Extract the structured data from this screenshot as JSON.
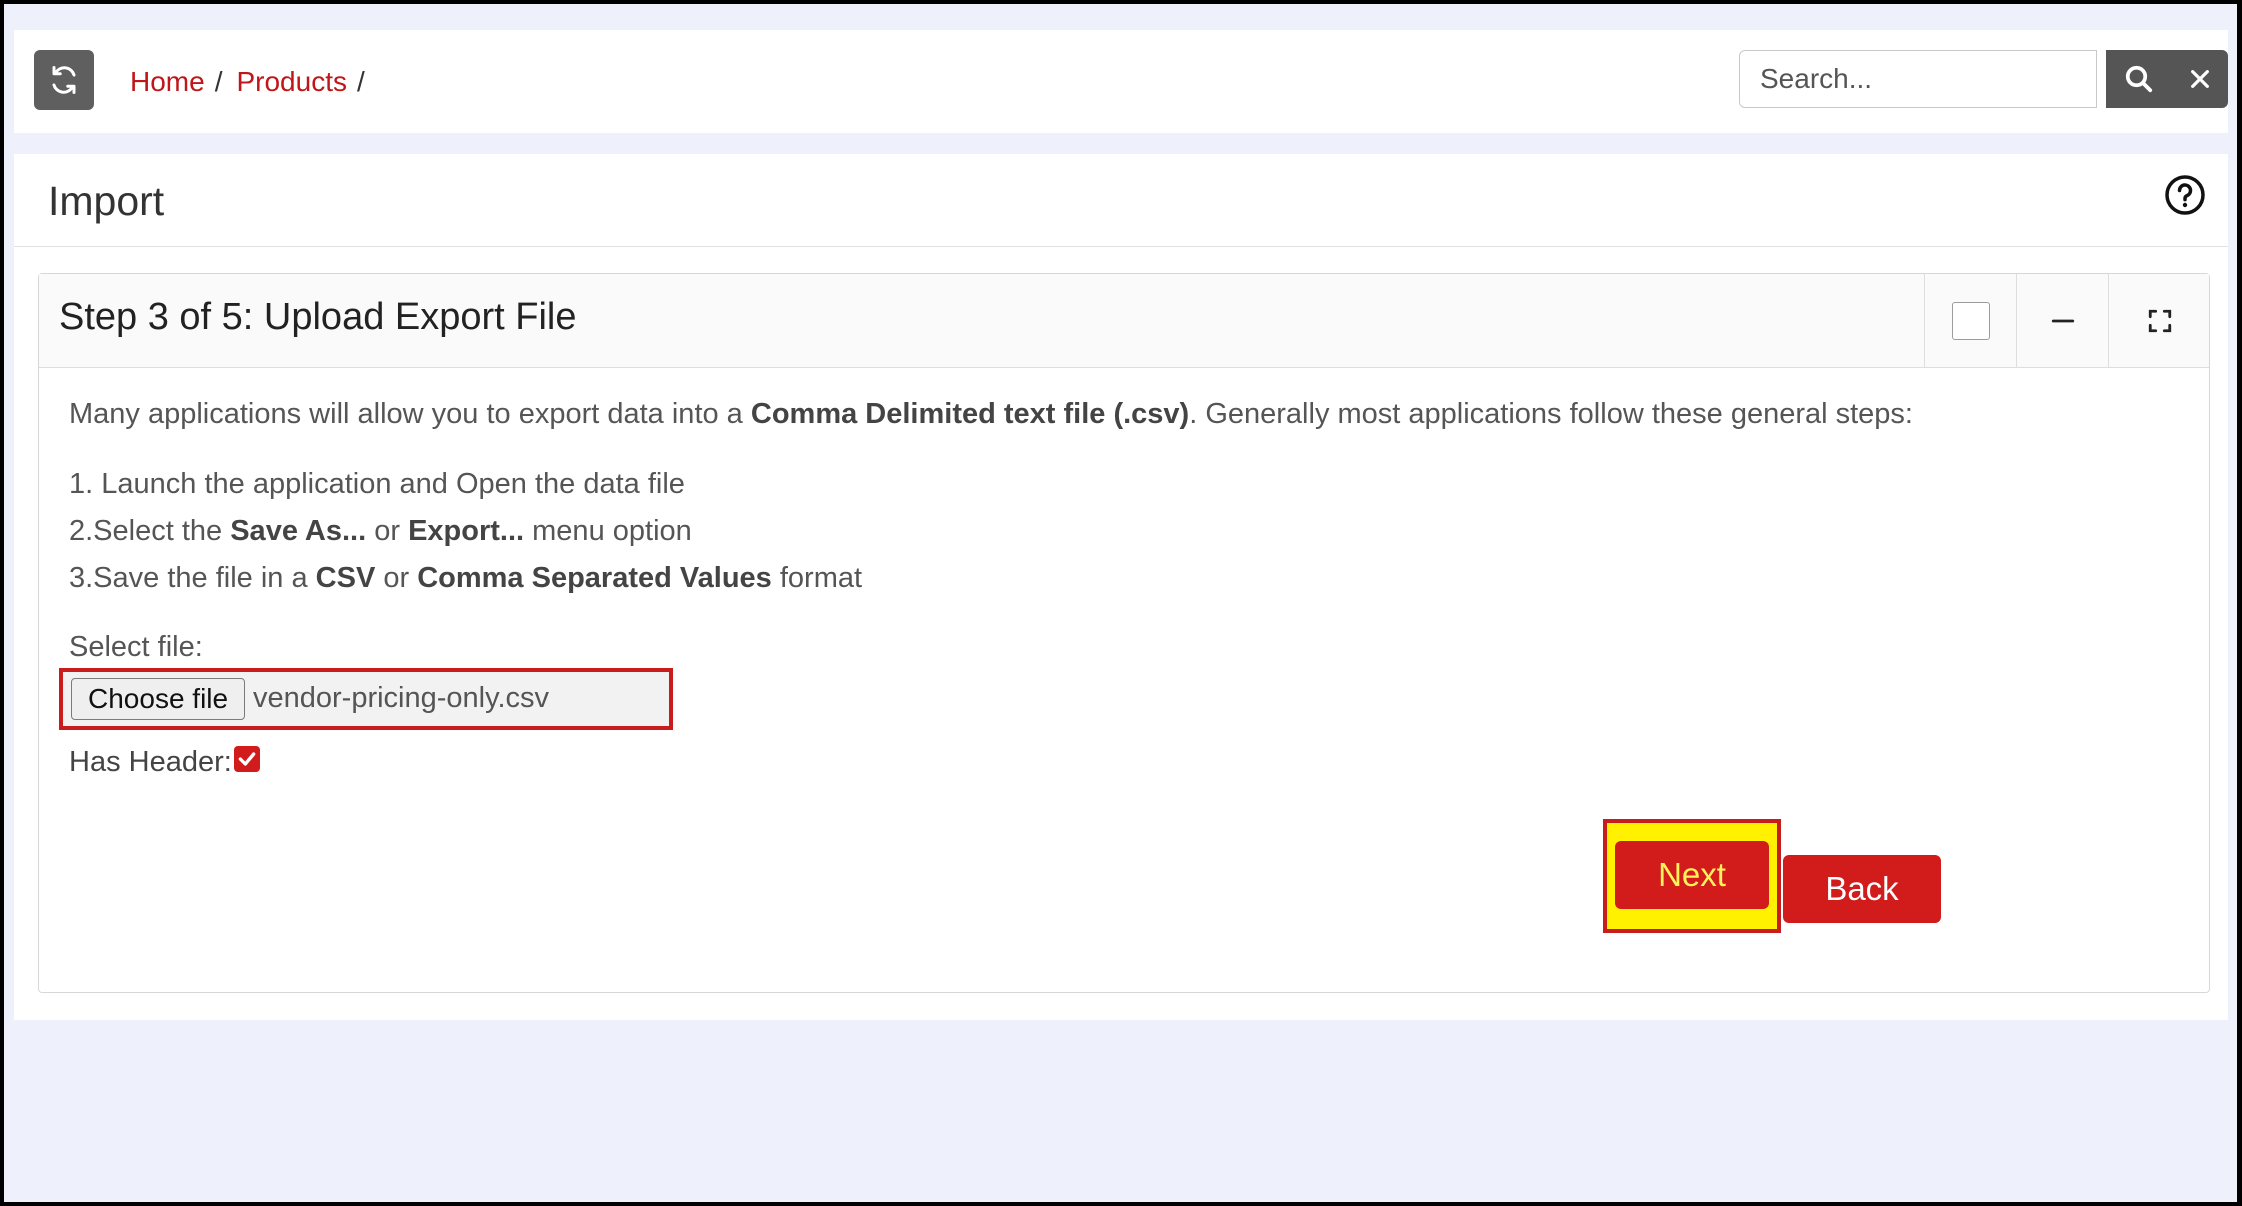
{
  "breadcrumb": {
    "home": "Home",
    "products": "Products",
    "sep1": "/",
    "sep2": "/"
  },
  "search": {
    "placeholder": "Search..."
  },
  "page": {
    "title": "Import"
  },
  "step_card": {
    "title": "Step 3 of 5: Upload Export File",
    "intro": {
      "before": "Many applications will allow you to export data into a ",
      "bold": "Comma Delimited text file (.csv)",
      "after": ". Generally most applications follow these general steps:"
    },
    "steps": [
      {
        "pre": "1. Launch the application and Open the data file"
      },
      {
        "pre": "2.Select the ",
        "b1": "Save As...",
        "mid": " or ",
        "b2": "Export...",
        "post": " menu option"
      },
      {
        "pre": "3.Save the file in a ",
        "b1": "CSV",
        "mid": " or ",
        "b2": "Comma Separated Values",
        "post": " format"
      }
    ],
    "select_file_label": "Select file:",
    "choose_file_label": "Choose file",
    "file_name": "vendor-pricing-only.csv",
    "has_header_label": "Has Header:",
    "has_header_checked": true,
    "next_label": "Next",
    "back_label": "Back"
  },
  "colors": {
    "accent_red": "#d21b1b",
    "highlight_yellow": "#fff100",
    "link_red": "#c0161a",
    "background": "#eef0fb"
  },
  "icons": [
    "refresh-icon",
    "search-icon",
    "close-icon",
    "help-icon",
    "minimize-icon",
    "fullscreen-icon",
    "checkmark-icon"
  ]
}
